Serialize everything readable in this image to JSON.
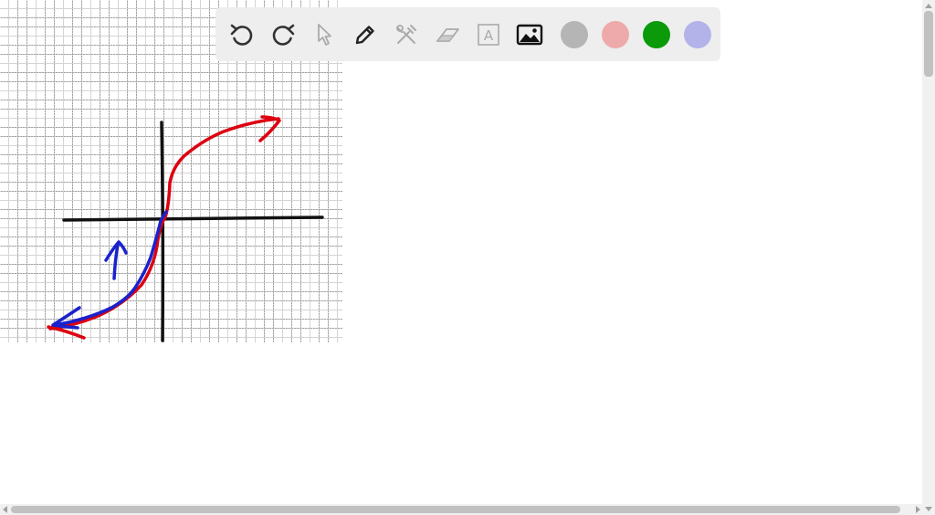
{
  "toolbar": {
    "tools": [
      {
        "name": "undo-icon",
        "enabled": true
      },
      {
        "name": "redo-icon",
        "enabled": true
      },
      {
        "name": "pointer-icon",
        "enabled": false
      },
      {
        "name": "pen-icon",
        "enabled": true
      },
      {
        "name": "tools-icon",
        "enabled": false
      },
      {
        "name": "eraser-icon",
        "enabled": false
      },
      {
        "name": "text-icon",
        "enabled": false
      },
      {
        "name": "image-icon",
        "enabled": true
      }
    ],
    "text_tool_glyph": "A",
    "colors": [
      "#b5b5b5",
      "#eeaaaa",
      "#0a9a0a",
      "#b3b3ea"
    ]
  },
  "sketch_colors": {
    "axes": "#111111",
    "red_curve": "#dd0010",
    "blue_curve": "#1a22cc"
  }
}
